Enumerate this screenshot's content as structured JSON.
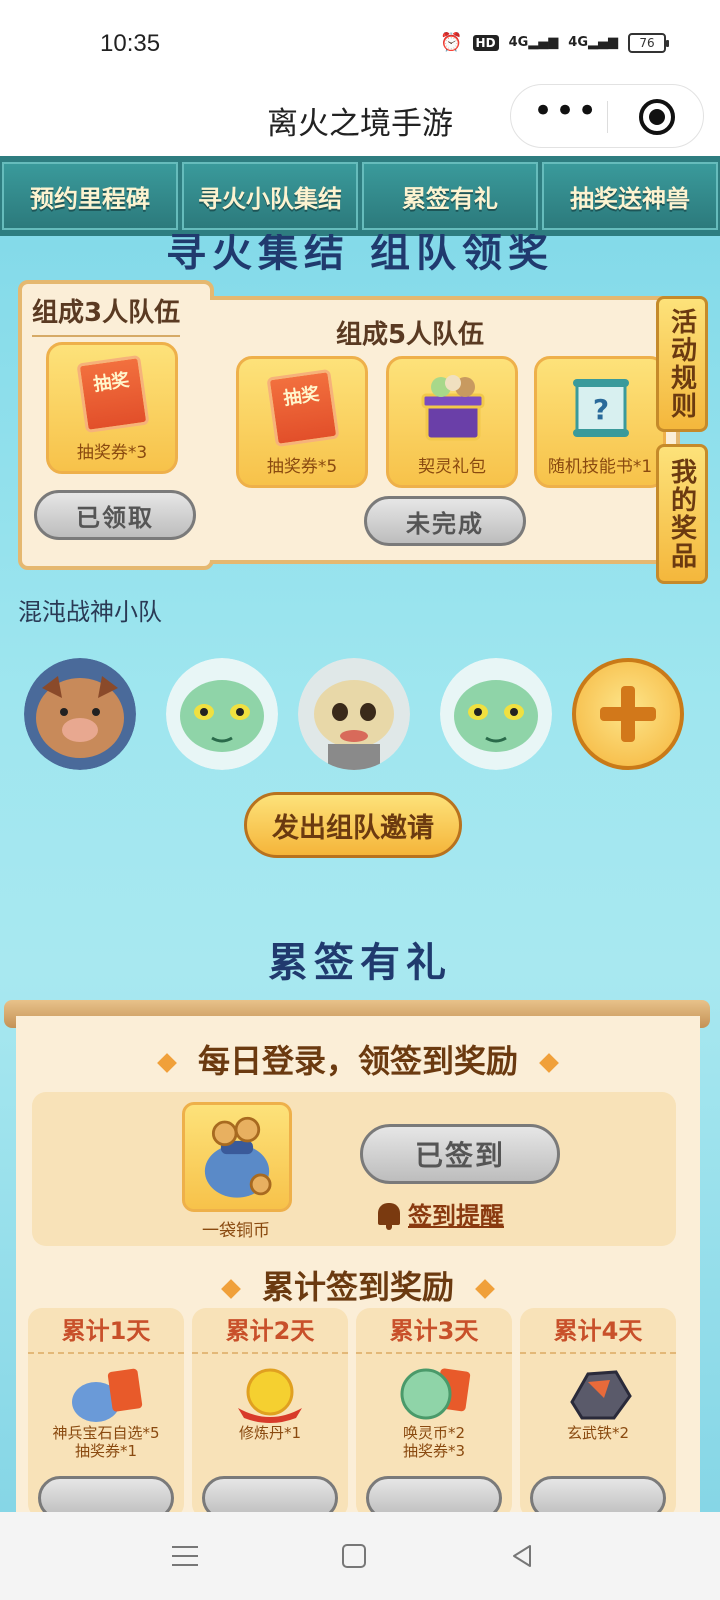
{
  "status_bar": {
    "time": "10:35",
    "hd": "HD",
    "sig1": "4G",
    "sig2": "4G",
    "battery": "76"
  },
  "title_bar": {
    "title": "离火之境手游"
  },
  "tabs": [
    "预约里程碑",
    "寻火小队集结",
    "累签有礼",
    "抽奖送神兽"
  ],
  "team": {
    "banner": "寻火集结 组队领奖",
    "three": {
      "title": "组成3人队伍",
      "prize_label": "抽奖券*3",
      "ticket_text": "抽奖",
      "button": "已领取"
    },
    "five": {
      "title": "组成5人队伍",
      "prizes": [
        {
          "label": "抽奖券*5",
          "icon": "lottery-ticket"
        },
        {
          "label": "契灵礼包",
          "icon": "spirit-gift-box"
        },
        {
          "label": "随机技能书*1",
          "icon": "skill-scroll"
        }
      ],
      "button": "未完成"
    },
    "side_rules": "活动规则",
    "side_prizes": "我的奖品",
    "name": "混沌战神小队",
    "invite_button": "发出组队邀请"
  },
  "signin": {
    "banner": "累签有礼",
    "daily_title": "每日登录，领签到奖励",
    "daily_item": "一袋铜币",
    "signed_button": "已签到",
    "remind": "签到提醒",
    "cumulative_title": "累计签到奖励",
    "cumulative": [
      {
        "day": "累计1天",
        "reward": "神兵宝石自选*5",
        "reward2": "抽奖券*1"
      },
      {
        "day": "累计2天",
        "reward": "修炼丹*1",
        "reward2": ""
      },
      {
        "day": "累计3天",
        "reward": "唤灵币*2",
        "reward2": "抽奖券*3"
      },
      {
        "day": "累计4天",
        "reward": "玄武铁*2",
        "reward2": ""
      }
    ]
  },
  "colors": {
    "teal": "#2e7d80",
    "gold": "#f5b53a",
    "parchment": "#fbeed7",
    "sky": "#9fe6ef"
  }
}
